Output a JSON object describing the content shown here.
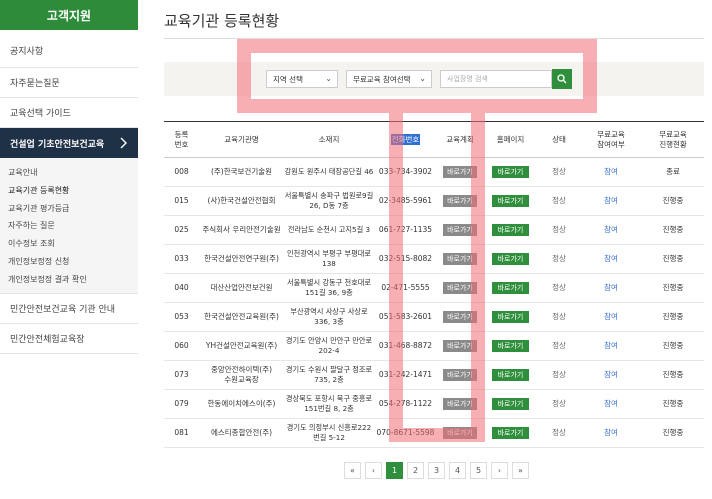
{
  "sidebar": {
    "header": "고객지원",
    "items": [
      "공지사항",
      "자주묻는질문",
      "교육선택 가이드"
    ],
    "active": "건설업 기초안전보건교육",
    "active_icon": "chevron-right-icon",
    "sub_items": [
      "교육안내",
      "교육기관 등록현황",
      "교육기관 평가등급",
      "자주하는 질문",
      "이수정보 조회",
      "개인정보정정 신청",
      "개인정보정정 결과 확인"
    ],
    "bottom_items": [
      "민간안전보건교육 기관 안내",
      "민간안전체험교육장"
    ]
  },
  "page": {
    "title": "교육기관 등록현황"
  },
  "search": {
    "region_select": "지역 선택",
    "free_select": "무료교육 참여선택",
    "placeholder": "사업장명 검색",
    "button_icon": "search-icon"
  },
  "table": {
    "headers": [
      "등록\n번호",
      "교육기관명",
      "소재지",
      "전화번호",
      "교육계획",
      "홈페이지",
      "상태",
      "무료교육\n참여여부",
      "무료교육\n진행현황"
    ],
    "plan_label": "바로가기",
    "home_label": "바로가기",
    "rows": [
      {
        "no": "008",
        "name": "(주)한국보건기술원",
        "addr": "강원도 원주시 태장공단길 46",
        "tel": "033-734-3902",
        "state": "정상",
        "part": "참여",
        "progress": "종료"
      },
      {
        "no": "015",
        "name": "(사)한국건설안전협회",
        "addr": "서울특별시 송파구 법원로9길 26, D동 7층",
        "tel": "02-3485-5961",
        "state": "정상",
        "part": "참여",
        "progress": "진행중"
      },
      {
        "no": "025",
        "name": "주식회사 우리안전기술원",
        "addr": "전라남도 순천시 고지5길 3",
        "tel": "061-727-1135",
        "state": "정상",
        "part": "참여",
        "progress": "진행중"
      },
      {
        "no": "033",
        "name": "한국건설안전연구원(주)",
        "addr": "인천광역시 부평구 부평대로 138",
        "tel": "032-515-8082",
        "state": "정상",
        "part": "참여",
        "progress": "진행중"
      },
      {
        "no": "040",
        "name": "대산산업안전보건원",
        "addr": "서울특별시 강동구 천호대로151길 36, 9층",
        "tel": "02-471-5555",
        "state": "정상",
        "part": "참여",
        "progress": "진행중"
      },
      {
        "no": "053",
        "name": "한국건설안전교육원(주)",
        "addr": "부산광역시 사상구 사상로 336, 3층",
        "tel": "051-583-2601",
        "state": "정상",
        "part": "참여",
        "progress": "진행중"
      },
      {
        "no": "060",
        "name": "YH건설안전교육원(주)",
        "addr": "경기도 안양시 만안구 만안로 202-4",
        "tel": "031-468-8872",
        "state": "정상",
        "part": "참여",
        "progress": "진행중"
      },
      {
        "no": "073",
        "name": "중앙안전하이텍(주)\n수원교육장",
        "addr": "경기도 수원시 팔달구 정조로 735, 2층",
        "tel": "031-242-1471",
        "state": "정상",
        "part": "참여",
        "progress": "진행중"
      },
      {
        "no": "079",
        "name": "한동에이치에스이(주)",
        "addr": "경상북도 포항시 북구 중흥로151번길 8, 2층",
        "tel": "054-278-1122",
        "state": "정상",
        "part": "참여",
        "progress": "진행중"
      },
      {
        "no": "081",
        "name": "에스티종합안전(주)",
        "addr": "경기도 의정부시 신흥로222번길 5-12",
        "tel": "070-8671-5598",
        "state": "정상",
        "part": "참여",
        "progress": "진행중"
      }
    ]
  },
  "pager": {
    "pages": [
      "1",
      "2",
      "3",
      "4",
      "5"
    ],
    "current": "1",
    "first": "«",
    "prev": "‹",
    "next": "›",
    "last": "»"
  },
  "colors": {
    "green": "#2f8f3c",
    "navy": "#1f3147",
    "overlay": "#f26e76",
    "highlight": "#2f6fd1"
  }
}
